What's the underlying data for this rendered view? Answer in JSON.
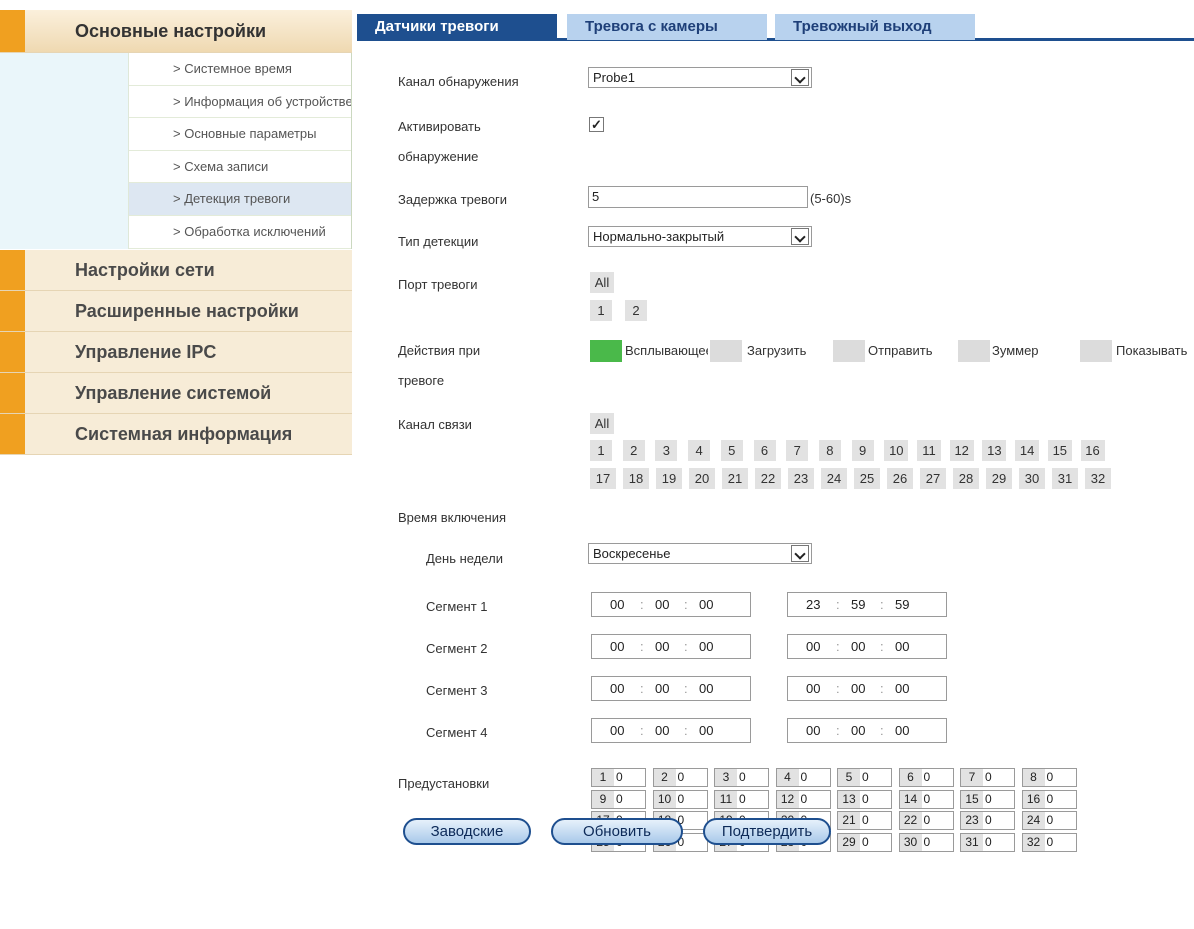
{
  "sidebar": {
    "sections": [
      {
        "label": "Основные настройки"
      },
      {
        "label": "Настройки сети"
      },
      {
        "label": "Расширенные настройки"
      },
      {
        "label": "Управление IPC"
      },
      {
        "label": "Управление системой"
      },
      {
        "label": "Системная информация"
      }
    ],
    "subitems": [
      {
        "label": "> Системное время"
      },
      {
        "label": "> Информация об устройстве"
      },
      {
        "label": "> Основные параметры"
      },
      {
        "label": "> Схема записи"
      },
      {
        "label": "> Детекция тревоги"
      },
      {
        "label": "> Обработка исключений"
      }
    ]
  },
  "tabs": [
    {
      "label": "Датчики тревоги"
    },
    {
      "label": "Тревога с камеры"
    },
    {
      "label": "Тревожный выход"
    }
  ],
  "form": {
    "channel_label": "Канал обнаружения",
    "channel_value": "Probe1",
    "activate_label_1": "Активировать",
    "activate_label_2": "обнаружение",
    "activate_checked": "✓",
    "delay_label": "Задержка тревоги",
    "delay_value": "5",
    "delay_range": "(5-60)s",
    "type_label": "Тип детекции",
    "type_value": "Нормально-закрытый",
    "port_label": "Порт тревоги",
    "port_all": "All",
    "ports": [
      "1",
      "2"
    ],
    "actions_label_1": "Действия при",
    "actions_label_2": "тревоге",
    "actions": [
      {
        "label": "Всплывающее",
        "enabled": true
      },
      {
        "label": "Загрузить",
        "enabled": false
      },
      {
        "label": "Отправить",
        "enabled": false
      },
      {
        "label": "Зуммер",
        "enabled": false
      },
      {
        "label": "Показывать",
        "enabled": false
      }
    ],
    "link_label": "Канал связи",
    "link_all": "All",
    "link_row1": [
      "1",
      "2",
      "3",
      "4",
      "5",
      "6",
      "7",
      "8",
      "9",
      "10",
      "11",
      "12",
      "13",
      "14",
      "15",
      "16"
    ],
    "link_row2": [
      "17",
      "18",
      "19",
      "20",
      "21",
      "22",
      "23",
      "24",
      "25",
      "26",
      "27",
      "28",
      "29",
      "30",
      "31",
      "32"
    ],
    "schedule_label": "Время включения",
    "weekday_label": "День недели",
    "weekday_value": "Воскресенье",
    "segments": [
      {
        "label": "Сегмент 1",
        "start": [
          "00",
          "00",
          "00"
        ],
        "end": [
          "23",
          "59",
          "59"
        ]
      },
      {
        "label": "Сегмент 2",
        "start": [
          "00",
          "00",
          "00"
        ],
        "end": [
          "00",
          "00",
          "00"
        ]
      },
      {
        "label": "Сегмент 3",
        "start": [
          "00",
          "00",
          "00"
        ],
        "end": [
          "00",
          "00",
          "00"
        ]
      },
      {
        "label": "Сегмент 4",
        "start": [
          "00",
          "00",
          "00"
        ],
        "end": [
          "00",
          "00",
          "00"
        ]
      }
    ],
    "time_sep": ":",
    "presets_label": "Предустановки",
    "presets": [
      {
        "n": "1",
        "v": "0"
      },
      {
        "n": "2",
        "v": "0"
      },
      {
        "n": "3",
        "v": "0"
      },
      {
        "n": "4",
        "v": "0"
      },
      {
        "n": "5",
        "v": "0"
      },
      {
        "n": "6",
        "v": "0"
      },
      {
        "n": "7",
        "v": "0"
      },
      {
        "n": "8",
        "v": "0"
      },
      {
        "n": "9",
        "v": "0"
      },
      {
        "n": "10",
        "v": "0"
      },
      {
        "n": "11",
        "v": "0"
      },
      {
        "n": "12",
        "v": "0"
      },
      {
        "n": "13",
        "v": "0"
      },
      {
        "n": "14",
        "v": "0"
      },
      {
        "n": "15",
        "v": "0"
      },
      {
        "n": "16",
        "v": "0"
      },
      {
        "n": "17",
        "v": "0"
      },
      {
        "n": "18",
        "v": "0"
      },
      {
        "n": "19",
        "v": "0"
      },
      {
        "n": "20",
        "v": "0"
      },
      {
        "n": "21",
        "v": "0"
      },
      {
        "n": "22",
        "v": "0"
      },
      {
        "n": "23",
        "v": "0"
      },
      {
        "n": "24",
        "v": "0"
      },
      {
        "n": "25",
        "v": "0"
      },
      {
        "n": "26",
        "v": "0"
      },
      {
        "n": "27",
        "v": "0"
      },
      {
        "n": "28",
        "v": "0"
      },
      {
        "n": "29",
        "v": "0"
      },
      {
        "n": "30",
        "v": "0"
      },
      {
        "n": "31",
        "v": "0"
      },
      {
        "n": "32",
        "v": "0"
      }
    ]
  },
  "buttons": {
    "defaults": "Заводские",
    "refresh": "Обновить",
    "confirm": "Подтвердить"
  },
  "colors": {
    "accent": "#1e4f8f",
    "sidebar_bar": "#f0a020",
    "action_on": "#4ab94a"
  }
}
